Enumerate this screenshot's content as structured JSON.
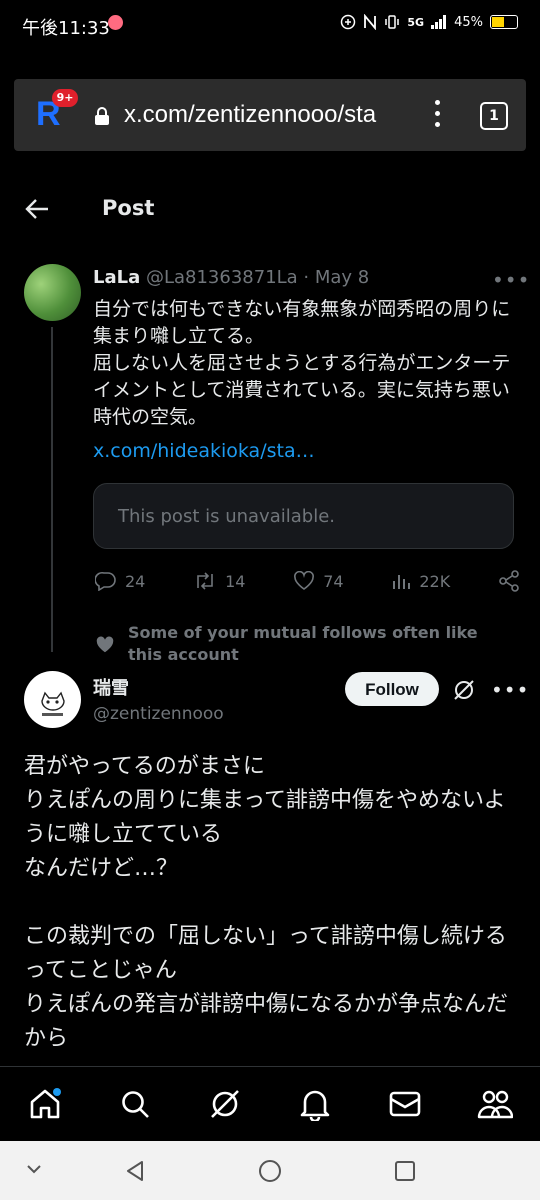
{
  "status_bar": {
    "time": "午後11:33",
    "battery": "45%",
    "network": "5G"
  },
  "browser": {
    "url": "x.com/zentizennooo/sta",
    "badge": "9+",
    "tab_count": "1",
    "logo": "R"
  },
  "header": {
    "title": "Post"
  },
  "tweet1": {
    "name": "LaLa",
    "meta": "@La81363871La · May 8",
    "body": "自分では何もできない有象無象が岡秀昭の周りに集まり囃し立てる。\n屈しない人を屈させようとする行為がエンターテイメントとして消費されている。実に気持ち悪い時代の空気。",
    "link": "x.com/hideakioka/sta…",
    "unavailable": "This post is unavailable.",
    "replies": "24",
    "reposts": "14",
    "likes": "74",
    "views": "22K"
  },
  "context": {
    "text": "Some of your mutual follows often like this account"
  },
  "tweet2": {
    "name": "瑞雪",
    "handle": "@zentizennooo",
    "follow_label": "Follow",
    "lines": [
      "君がやってるのがまさに",
      "りえぽんの周りに集まって誹謗中傷をやめないように囃し立てている",
      "なんだけど…？",
      "",
      "この裁判での「屈しない」って誹謗中傷し続けるってことじゃん",
      "りえぽんの発言が誹謗中傷になるかが争点なんだから"
    ]
  },
  "nav": {
    "items": [
      "home-icon",
      "search-icon",
      "grok-icon",
      "notifications-icon",
      "messages-icon",
      "communities-icon"
    ]
  },
  "colors": {
    "accent": "#1d9bf0",
    "background": "#000000",
    "muted": "#71767b"
  }
}
